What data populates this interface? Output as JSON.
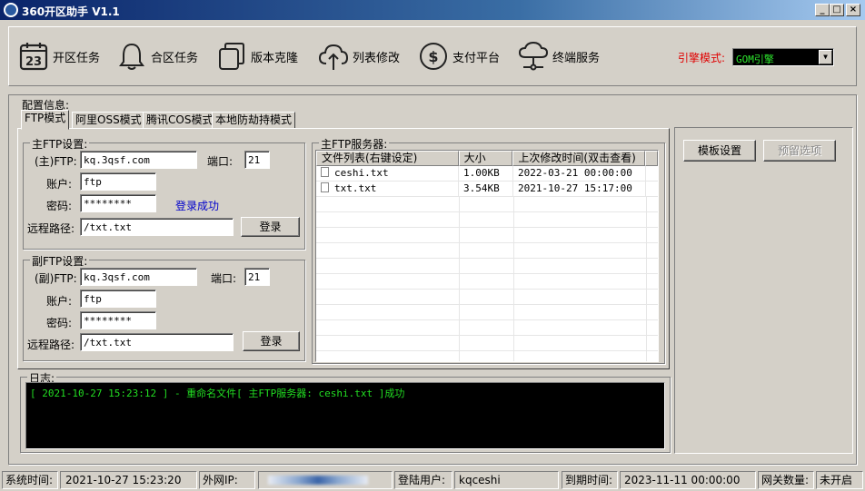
{
  "window": {
    "title": "360开区助手 V1.1",
    "min": "_",
    "max": "□",
    "close": "×"
  },
  "toolbar": {
    "items": [
      {
        "label": "开区任务",
        "icon": "calendar-icon",
        "badge": "23"
      },
      {
        "label": "合区任务",
        "icon": "bell-icon"
      },
      {
        "label": "版本克隆",
        "icon": "copy-icon"
      },
      {
        "label": "列表修改",
        "icon": "cloud-upload-icon"
      },
      {
        "label": "支付平台",
        "icon": "dollar-icon"
      },
      {
        "label": "终端服务",
        "icon": "cloud-network-icon"
      }
    ],
    "engine_label": "引擎模式:",
    "engine_value": "GOM引擎"
  },
  "config": {
    "title": "配置信息:",
    "tabs": [
      "FTP模式",
      "阿里OSS模式",
      "腾讯COS模式",
      "本地防劫持模式"
    ],
    "main_ftp": {
      "title": "主FTP设置:",
      "host_label": "(主)FTP:",
      "host": "kq.3qsf.com",
      "port_label": "端口:",
      "port": "21",
      "user_label": "账户:",
      "user": "ftp",
      "pass_label": "密码:",
      "pass": "********",
      "status": "登录成功",
      "path_label": "远程路径:",
      "path": "/txt.txt",
      "login": "登录"
    },
    "sub_ftp": {
      "title": "副FTP设置:",
      "host_label": "(副)FTP:",
      "host": "kq.3qsf.com",
      "port_label": "端口:",
      "port": "21",
      "user_label": "账户:",
      "user": "ftp",
      "pass_label": "密码:",
      "pass": "********",
      "path_label": "远程路径:",
      "path": "/txt.txt",
      "login": "登录"
    },
    "server": {
      "title": "主FTP服务器:",
      "columns": [
        "文件列表(右键设定)",
        "大小",
        "上次修改时间(双击查看)"
      ],
      "rows": [
        {
          "name": "ceshi.txt",
          "size": "1.00KB",
          "time": "2022-03-21 00:00:00"
        },
        {
          "name": "txt.txt",
          "size": "3.54KB",
          "time": "2021-10-27 15:17:00"
        }
      ]
    }
  },
  "side": {
    "template": "模板设置",
    "reserve": "预留选项"
  },
  "log": {
    "title": "日志:",
    "lines": [
      "[ 2021-10-27 15:23:12 ] -  重命名文件[ 主FTP服务器: ceshi.txt ]成功"
    ]
  },
  "statusbar": {
    "sys_time_label": "系统时间:",
    "sys_time": "2021-10-27 15:23:20",
    "ip_label": "外网IP:",
    "user_label": "登陆用户:",
    "user": "kqceshi",
    "expire_label": "到期时间:",
    "expire": "2023-11-11 00:00:00",
    "gw_label": "网关数量:",
    "gw": "未开启"
  }
}
